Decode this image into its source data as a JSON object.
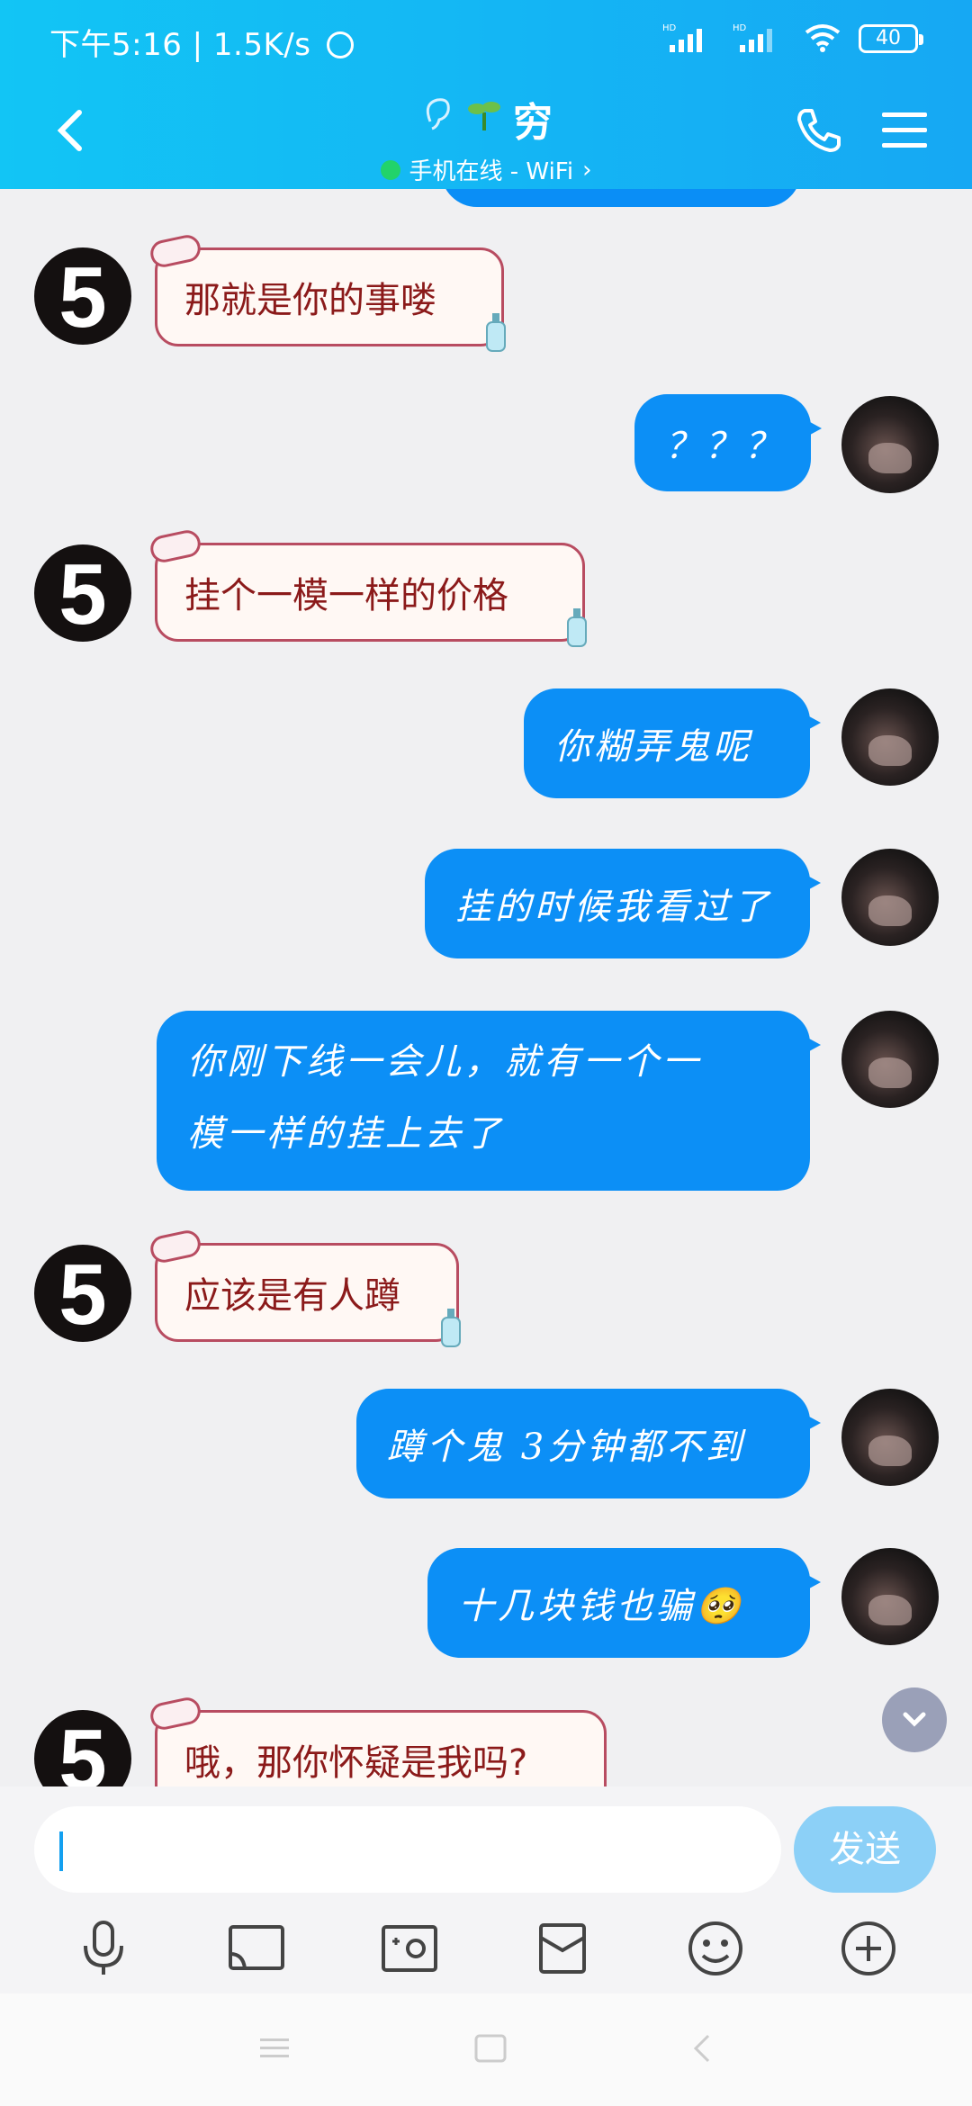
{
  "status_bar": {
    "time_speed": "下午5:16 | 1.5K/s",
    "battery": "40",
    "signal1": "HD",
    "signal2": "HD"
  },
  "header": {
    "title": "穷",
    "subtitle": "手机在线 - WiFi",
    "subtitle_arrow": "›"
  },
  "messages": [
    {
      "side": "left",
      "text": "那就是你的事喽"
    },
    {
      "side": "right",
      "text": "？？？"
    },
    {
      "side": "left",
      "text": "挂个一模一样的价格"
    },
    {
      "side": "right",
      "text": "你糊弄鬼呢"
    },
    {
      "side": "right",
      "text": "挂的时候我看过了"
    },
    {
      "side": "right",
      "line1": "你刚下线一会儿，就有一个一",
      "line2": "模一样的挂上去了"
    },
    {
      "side": "left",
      "text": "应该是有人蹲"
    },
    {
      "side": "right",
      "text": "蹲个鬼  3分钟都不到"
    },
    {
      "side": "right",
      "text": "十几块钱也骗🥺"
    },
    {
      "side": "left",
      "text": "哦，那你怀疑是我吗?"
    }
  ],
  "avatar_left_label": "5",
  "input": {
    "placeholder": "",
    "send_label": "发送"
  },
  "colors": {
    "header": "#16a8f3",
    "bubble_right": "#0c8ff6",
    "bubble_left_border": "#b84c61",
    "bubble_left_text": "#8b1a1a"
  }
}
